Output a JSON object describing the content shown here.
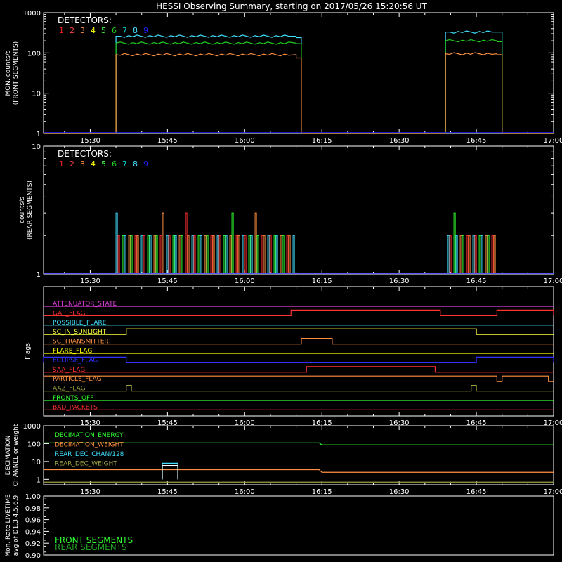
{
  "title": "HESSI Observing Summary, starting on 2017/05/26 15:20:56 UT",
  "time_ticks": [
    "15:30",
    "15:45",
    "16:00",
    "16:15",
    "16:30",
    "16:45",
    "17:00"
  ],
  "colors": {
    "background": "#000000",
    "axes": "#ffffff",
    "text": "#ffffff",
    "detectors": [
      "#ff2020",
      "#ff4040",
      "#ff9040",
      "#ffff00",
      "#40ff40",
      "#20d020",
      "#00d0d0",
      "#40e0ff",
      "#2020ff"
    ]
  },
  "chart_data": [
    {
      "type": "line",
      "panel": "front",
      "ylabel_lines": [
        "MON. counts/s",
        "(FRONT SEGMENTS)"
      ],
      "ylog": true,
      "ylim": [
        1,
        1000
      ],
      "yticks": [
        "1",
        "10",
        "100",
        "1000"
      ],
      "legend_title": "DETECTORS:",
      "detectors": [
        "1",
        "2",
        "3",
        "4",
        "5",
        "6",
        "7",
        "8",
        "9"
      ],
      "series": [
        {
          "name": "8",
          "color": "#40e0ff",
          "x": [
            "15:20:56",
            "15:34",
            "15:35",
            "16:10",
            "16:11",
            "16:38",
            "16:39",
            "16:49",
            "16:50",
            "17:00"
          ],
          "y": [
            1,
            1,
            260,
            240,
            1,
            1,
            330,
            330,
            1,
            1
          ]
        },
        {
          "name": "6",
          "color": "#20d020",
          "x": [
            "15:20:56",
            "15:34",
            "15:35",
            "16:10",
            "16:11",
            "16:38",
            "16:39",
            "16:49",
            "16:50",
            "17:00"
          ],
          "y": [
            1,
            1,
            175,
            170,
            1,
            1,
            200,
            190,
            1,
            1
          ]
        },
        {
          "name": "3",
          "color": "#ff9040",
          "x": [
            "15:20:56",
            "15:34",
            "15:35",
            "16:10",
            "16:11",
            "16:38",
            "16:39",
            "16:49",
            "16:50",
            "17:00"
          ],
          "y": [
            1,
            1,
            90,
            75,
            1,
            1,
            95,
            90,
            1,
            1
          ]
        }
      ]
    },
    {
      "type": "line",
      "panel": "rear",
      "ylabel_lines": [
        "counts/s",
        "(REAR SEGMENTS)"
      ],
      "ylog": true,
      "ylim": [
        1,
        10
      ],
      "yticks": [
        "1",
        "10"
      ],
      "legend_title": "DETECTORS:",
      "detectors": [
        "1",
        "2",
        "3",
        "4",
        "5",
        "6",
        "7",
        "8",
        "9"
      ],
      "active_windows": [
        [
          "15:35",
          "16:10"
        ],
        [
          "16:39",
          "16:49"
        ]
      ],
      "levels": [
        1,
        2,
        3
      ]
    },
    {
      "type": "line",
      "panel": "flags",
      "ylabel": "Flags",
      "flags": [
        {
          "name": "ATTENUATOR_STATE",
          "color": "#e040e0"
        },
        {
          "name": "GAP_FLAG",
          "color": "#ff3030"
        },
        {
          "name": "POSSIBLE_FLARE",
          "color": "#40e0ff"
        },
        {
          "name": "SC_IN_SUNLIGHT",
          "color": "#ffff40"
        },
        {
          "name": "SC_TRANSMITTER",
          "color": "#ff9040"
        },
        {
          "name": "FLARE_FLAG",
          "color": "#ffff00"
        },
        {
          "name": "ECLIPSE_FLAG",
          "color": "#3030ff"
        },
        {
          "name": "SAA_FLAG",
          "color": "#ff3030"
        },
        {
          "name": "PARTICLE_FLAG",
          "color": "#ff9040"
        },
        {
          "name": "AAZ_FLAG",
          "color": "#a0a040"
        },
        {
          "name": "FRONTS_OFF",
          "color": "#30ff30"
        },
        {
          "name": "BAD_PACKETS",
          "color": "#ff3030"
        }
      ],
      "flag_on_intervals": {
        "GAP_FLAG": [
          [
            "16:09",
            "16:38"
          ],
          [
            "16:49",
            "17:00"
          ]
        ],
        "SC_IN_SUNLIGHT": [
          [
            "15:37",
            "16:45"
          ]
        ],
        "SC_TRANSMITTER": [
          [
            "16:11",
            "16:17"
          ]
        ],
        "ECLIPSE_FLAG": [
          [
            "15:20:56",
            "15:37"
          ],
          [
            "16:45",
            "17:00"
          ]
        ],
        "SAA_FLAG": [
          [
            "16:12",
            "16:37"
          ]
        ],
        "PARTICLE_FLAG": [
          [
            "15:21",
            "16:49"
          ],
          [
            "16:50",
            "16:59"
          ]
        ],
        "AAZ_FLAG": [
          [
            "15:37",
            "15:38"
          ],
          [
            "16:44",
            "16:45"
          ]
        ]
      }
    },
    {
      "type": "line",
      "panel": "decimation",
      "ylabel_lines": [
        "DECIMATION",
        "CHANNEL or weight"
      ],
      "ylog": true,
      "ylim": [
        0.5,
        1000
      ],
      "yticks": [
        "1",
        "10",
        "100",
        "1000"
      ],
      "series": [
        {
          "name": "DECIMATION_ENERGY",
          "color": "#30ff30",
          "x": [
            "15:20:56",
            "16:15",
            "17:00"
          ],
          "y": [
            110,
            110,
            85
          ]
        },
        {
          "name": "DECIMATION_WEIGHT",
          "color": "#ff9040",
          "x": [
            "15:20:56",
            "16:15",
            "17:00"
          ],
          "y": [
            3.5,
            3.5,
            2.5
          ]
        },
        {
          "name": "REAR_DEC_CHAN/128",
          "color": "#40e0ff",
          "x": [
            "15:44",
            "15:44",
            "15:47",
            "15:47"
          ],
          "y": [
            1,
            8,
            8,
            1
          ]
        },
        {
          "name": "REAR_DEC_WEIGHT",
          "color": "#a0a040",
          "x": [
            "15:20:56",
            "17:00"
          ],
          "y": [
            0.7,
            0.7
          ]
        }
      ]
    },
    {
      "type": "line",
      "panel": "livetime",
      "ylabel_lines": [
        "Mon. Rate LIVETIME",
        "avg of D1,3,4,5,6,9"
      ],
      "ylim": [
        0.9,
        1.0
      ],
      "yticks": [
        "0.90",
        "0.92",
        "0.94",
        "0.96",
        "0.98",
        "1.00"
      ],
      "series": [
        {
          "name": "FRONT SEGMENTS",
          "color": "#30ff30"
        },
        {
          "name": "REAR SEGMENTS",
          "color": "#20a020"
        }
      ]
    }
  ]
}
